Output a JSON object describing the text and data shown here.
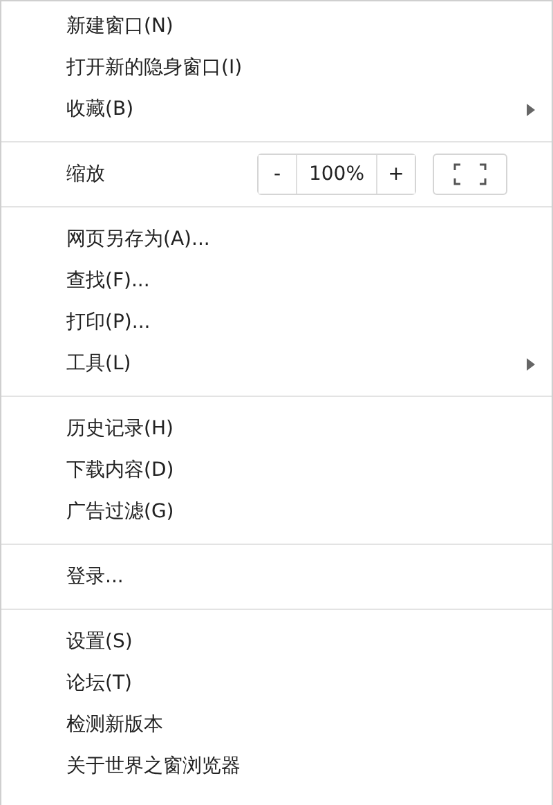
{
  "menu": {
    "sections": [
      {
        "items": [
          {
            "kind": "item",
            "label": "新建窗口(N)"
          },
          {
            "kind": "item",
            "label": "打开新的隐身窗口(I)"
          },
          {
            "kind": "submenu",
            "label": "收藏(B)"
          }
        ]
      },
      {
        "items": [
          {
            "kind": "zoom",
            "label": "缩放",
            "minus": "-",
            "value": "100%",
            "plus": "+"
          }
        ]
      },
      {
        "items": [
          {
            "kind": "item",
            "label": "网页另存为(A)..."
          },
          {
            "kind": "item",
            "label": "查找(F)..."
          },
          {
            "kind": "item",
            "label": "打印(P)..."
          },
          {
            "kind": "submenu",
            "label": "工具(L)"
          }
        ]
      },
      {
        "items": [
          {
            "kind": "item",
            "label": "历史记录(H)"
          },
          {
            "kind": "item",
            "label": "下载内容(D)"
          },
          {
            "kind": "item",
            "label": "广告过滤(G)"
          }
        ]
      },
      {
        "items": [
          {
            "kind": "item",
            "label": "登录..."
          }
        ]
      },
      {
        "items": [
          {
            "kind": "item",
            "label": "设置(S)"
          },
          {
            "kind": "item",
            "label": "论坛(T)"
          },
          {
            "kind": "item",
            "label": "检测新版本"
          },
          {
            "kind": "item",
            "label": "关于世界之窗浏览器"
          }
        ]
      }
    ]
  }
}
